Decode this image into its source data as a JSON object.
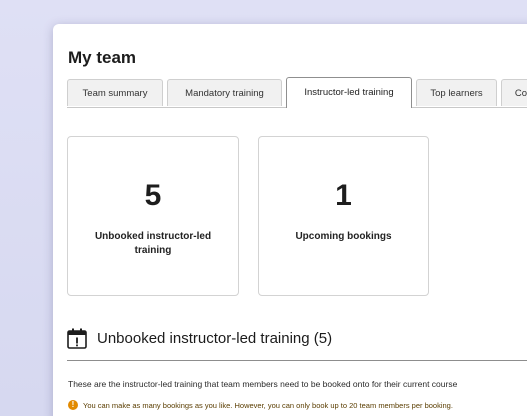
{
  "page": {
    "title": "My team"
  },
  "tabs": [
    {
      "label": "Team summary",
      "active": false
    },
    {
      "label": "Mandatory training",
      "active": false
    },
    {
      "label": "Instructor-led training",
      "active": true
    },
    {
      "label": "Top learners",
      "active": false
    },
    {
      "label": "Co",
      "active": false
    }
  ],
  "stats": [
    {
      "value": "5",
      "label": "Unbooked instructor-led training"
    },
    {
      "value": "1",
      "label": "Upcoming bookings"
    }
  ],
  "section": {
    "icon": "calendar-alert-icon",
    "title": "Unbooked instructor-led training (5)",
    "intro": "These are the instructor-led training that team members need to be booked onto for their current course",
    "warning_icon": "info-warning-icon",
    "warning": "You can make as many bookings as you like. However, you can only book up to 20 team members per booking."
  },
  "colors": {
    "backdrop": "#d9dbf2",
    "warning": "#e28a00"
  }
}
